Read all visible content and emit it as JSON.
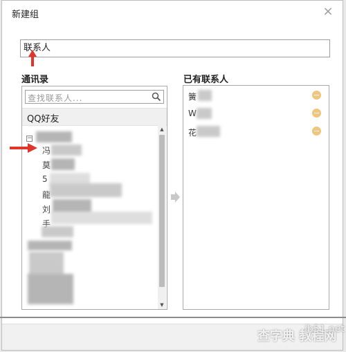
{
  "dialog": {
    "title": "新建组",
    "close_glyph": "×",
    "group_name_value": "联系人"
  },
  "contacts_section": {
    "label": "通讯录",
    "search_placeholder": "查找联系人...",
    "group_label": "QQ好友",
    "expander_glyph": "−",
    "visible_chars": [
      "冯",
      "莫",
      "5",
      "龍",
      "刘",
      "手"
    ]
  },
  "members_section": {
    "label": "已有联系人",
    "members": [
      {
        "name": "簧"
      },
      {
        "name": "W"
      },
      {
        "name": "花"
      }
    ]
  },
  "watermark": {
    "text": "查字典 教程网",
    "site": "jb51.net",
    "sub": "jiaocheng.chazidian.com"
  },
  "colors": {
    "remove_button": "#f0c57d",
    "annotation_arrow": "#e0352b"
  }
}
